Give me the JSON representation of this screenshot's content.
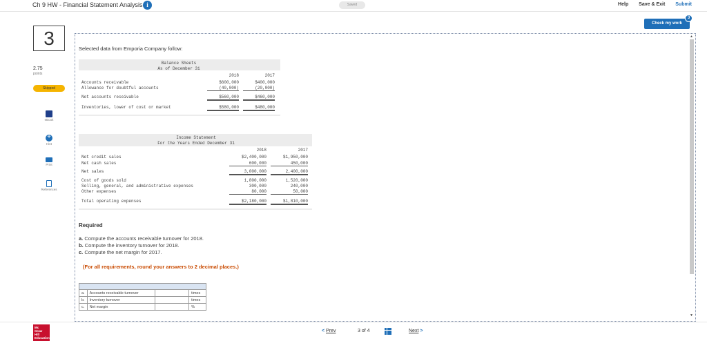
{
  "header": {
    "title": "Ch 9 HW - Financial Statement Analysis",
    "info_icon": "i",
    "saved": "Saved",
    "help": "Help",
    "save_exit": "Save & Exit",
    "submit": "Submit"
  },
  "check_work": {
    "label": "Check my work",
    "badge": "3"
  },
  "sidebar": {
    "question_number": "3",
    "points_value": "2.75",
    "points_label": "points",
    "status": "Skipped",
    "tools": [
      {
        "icon": "ebook-icon",
        "label": "eBook"
      },
      {
        "icon": "hint-icon",
        "label": "Hint"
      },
      {
        "icon": "print-icon",
        "label": "Print"
      },
      {
        "icon": "references-icon",
        "label": "References"
      }
    ]
  },
  "question": {
    "intro": "Selected data from Emporia Company follow:",
    "balance_sheet": {
      "title": "Balance Sheets",
      "subtitle": "As of December 31",
      "years": [
        "2018",
        "2017"
      ],
      "rows": [
        {
          "label": "Accounts receivable",
          "v2018": "$600,000",
          "v2017": "$400,000"
        },
        {
          "label": "Allowance for doubtful accounts",
          "v2018": "(40,000)",
          "v2017": "(20,000)"
        },
        {
          "label": "Net accounts receivable",
          "v2018": "$560,000",
          "v2017": "$460,000"
        },
        {
          "label": "Inventories, lower of cost or market",
          "v2018": "$580,000",
          "v2017": "$480,000"
        }
      ]
    },
    "income_statement": {
      "title": "Income Statement",
      "subtitle": "For the Years Ended December 31",
      "years": [
        "2018",
        "2017"
      ],
      "rows": [
        {
          "label": "Net credit sales",
          "v2018": "$2,400,000",
          "v2017": "$1,950,000"
        },
        {
          "label": "Net cash sales",
          "v2018": "600,000",
          "v2017": "450,000"
        },
        {
          "label": "Net sales",
          "v2018": "3,000,000",
          "v2017": "2,400,000"
        },
        {
          "label": "Cost of goods sold",
          "v2018": "1,800,000",
          "v2017": "1,520,000"
        },
        {
          "label": "Selling, general, and administrative expenses",
          "v2018": "300,000",
          "v2017": "240,000"
        },
        {
          "label": "Other expenses",
          "v2018": "80,000",
          "v2017": "50,000"
        },
        {
          "label": "Total operating expenses",
          "v2018": "$2,180,000",
          "v2017": "$1,810,000"
        }
      ]
    },
    "required": {
      "title": "Required",
      "items": [
        {
          "letter": "a.",
          "text": "Compute the accounts receivable turnover for 2018."
        },
        {
          "letter": "b.",
          "text": "Compute the inventory turnover for 2018."
        },
        {
          "letter": "c.",
          "text": "Compute the net margin for 2017."
        }
      ],
      "note": "(For all requirements, round your answers to 2 decimal places.)"
    },
    "answers": [
      {
        "letter": "a.",
        "label": "Accounts receivable turnover",
        "value": "",
        "unit": "times"
      },
      {
        "letter": "b.",
        "label": "Inventory turnover",
        "value": "",
        "unit": "times"
      },
      {
        "letter": "c.",
        "label": "Net margin",
        "value": "",
        "unit": "%"
      }
    ]
  },
  "footer": {
    "logo": [
      "Mc",
      "Graw",
      "Hill",
      "Education"
    ],
    "prev": "Prev",
    "position": "3 of 4",
    "next": "Next"
  }
}
